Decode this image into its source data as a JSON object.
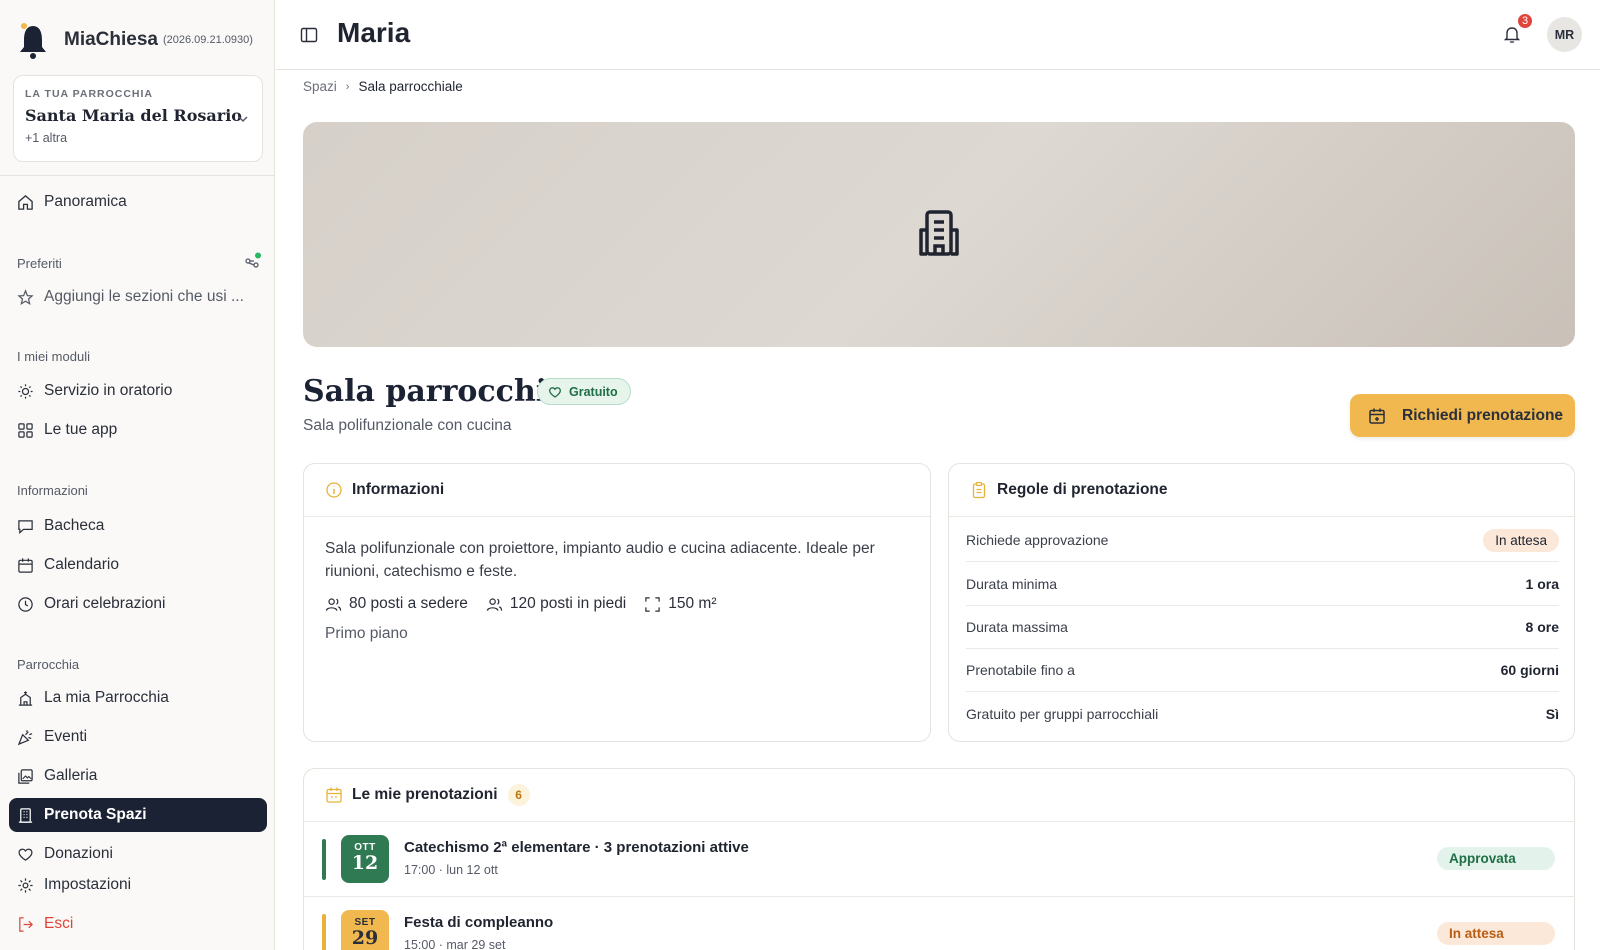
{
  "app": {
    "name": "MiaChiesa",
    "version": "(2026.09.21.0930)"
  },
  "parish": {
    "label": "LA TUA PARROCCHIA",
    "name": "Santa Maria del Rosario",
    "more": "+1 altra"
  },
  "sidebar": {
    "overview": "Panoramica",
    "favorites": {
      "title": "Preferiti",
      "placeholder": "Aggiungi le sezioni che usi ..."
    },
    "modules": {
      "title": "I miei moduli",
      "items": [
        "Servizio in oratorio",
        "Le tue app"
      ]
    },
    "info": {
      "title": "Informazioni",
      "items": [
        "Bacheca",
        "Calendario",
        "Orari celebrazioni"
      ]
    },
    "parish": {
      "title": "Parrocchia",
      "items": [
        "La mia Parrocchia",
        "Eventi",
        "Galleria",
        "Prenota Spazi",
        "Donazioni"
      ]
    },
    "settings": "Impostazioni",
    "logout": "Esci"
  },
  "header": {
    "title": "Maria",
    "notifications": "3",
    "avatar": "MR"
  },
  "breadcrumb": {
    "parent": "Spazi",
    "current": "Sala parrocchiale"
  },
  "space": {
    "title": "Sala parrocchiale",
    "tag": "Gratuito",
    "subtitle": "Sala polifunzionale con cucina",
    "action": "Richiedi prenotazione"
  },
  "info_card": {
    "title": "Informazioni",
    "description": "Sala polifunzionale con proiettore, impianto audio e cucina adiacente. Ideale per riunioni, catechismo e feste.",
    "features": [
      "80 posti a sedere",
      "120 posti in piedi",
      "150 m²"
    ],
    "floor": "Primo piano"
  },
  "rules_card": {
    "title": "Regole di prenotazione",
    "rows": [
      {
        "label": "Richiede approvazione",
        "value": "In attesa"
      },
      {
        "label": "Durata minima",
        "value": "1 ora"
      },
      {
        "label": "Durata massima",
        "value": "8 ore"
      },
      {
        "label": "Prenotabile fino a",
        "value": "60 giorni"
      },
      {
        "label": "Gratuito per gruppi parrocchiali",
        "value": "Sì"
      }
    ]
  },
  "bookings": {
    "title": "Le mie prenotazioni",
    "count": "6",
    "items": [
      {
        "month": "OTT",
        "day": "12",
        "title": "Catechismo 2ª elementare · 3 prenotazioni attive",
        "sub": "17:00 · lun 12 ott",
        "status": "Approvata"
      },
      {
        "month": "SET",
        "day": "29",
        "title": "Festa di compleanno",
        "sub": "15:00 · mar 29 set",
        "status": "In attesa"
      }
    ]
  },
  "colors": {
    "accent": "#f0b84f",
    "active_nav": "#1a2233",
    "approved": "#2f7a53",
    "pending": "#e8b23a",
    "danger": "#e0453a"
  }
}
